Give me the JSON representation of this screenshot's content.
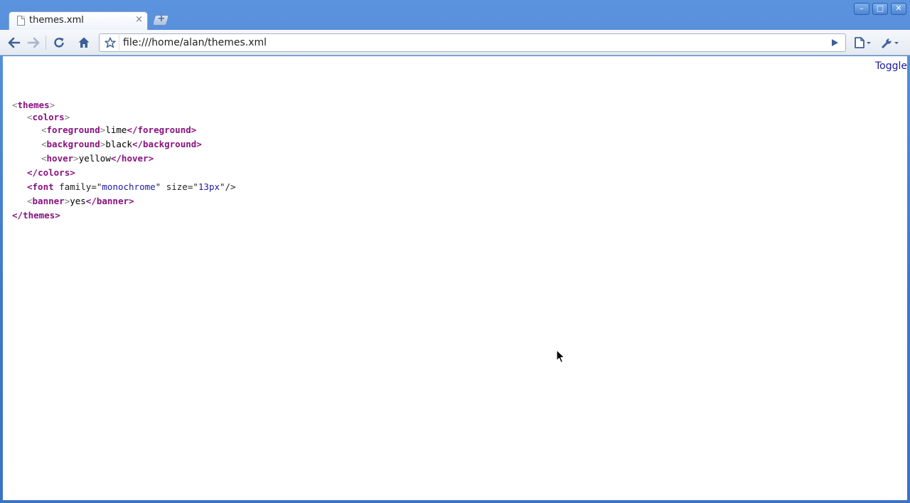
{
  "browser": {
    "tab": {
      "title": "themes.xml",
      "close_glyph": "×"
    },
    "new_tab_glyph": "+",
    "window_controls": {
      "minimize": "–",
      "maximize": "□",
      "close": "✕"
    },
    "toolbar": {
      "back_icon": "back-arrow-icon",
      "forward_icon": "forward-arrow-icon",
      "reload_icon": "reload-icon",
      "home_icon": "home-icon",
      "star_icon": "star-icon",
      "go_icon": "play-icon",
      "page_menu_icon": "page-menu-icon",
      "wrench_menu_icon": "wrench-icon"
    },
    "address": {
      "url": "file:///home/alan/themes.xml"
    }
  },
  "page": {
    "toggle_label": "Toggle",
    "xml": {
      "root_open": "themes",
      "colors_open": "colors",
      "foreground": {
        "tag": "foreground",
        "value": "lime"
      },
      "background": {
        "tag": "background",
        "value": "black"
      },
      "hover": {
        "tag": "hover",
        "value": "yellow"
      },
      "colors_close": "colors",
      "font": {
        "tag": "font",
        "attr1_name": "family",
        "attr1_value": "monochrome",
        "attr2_name": "size",
        "attr2_value": "13px"
      },
      "banner": {
        "tag": "banner",
        "value": "yes"
      },
      "root_close": "themes"
    }
  },
  "colors": {
    "titlebar": "#4a7fc9",
    "tag_color": "#881280",
    "attr_value_color": "#1a1aa6",
    "link_color": "#1a1a9e"
  }
}
